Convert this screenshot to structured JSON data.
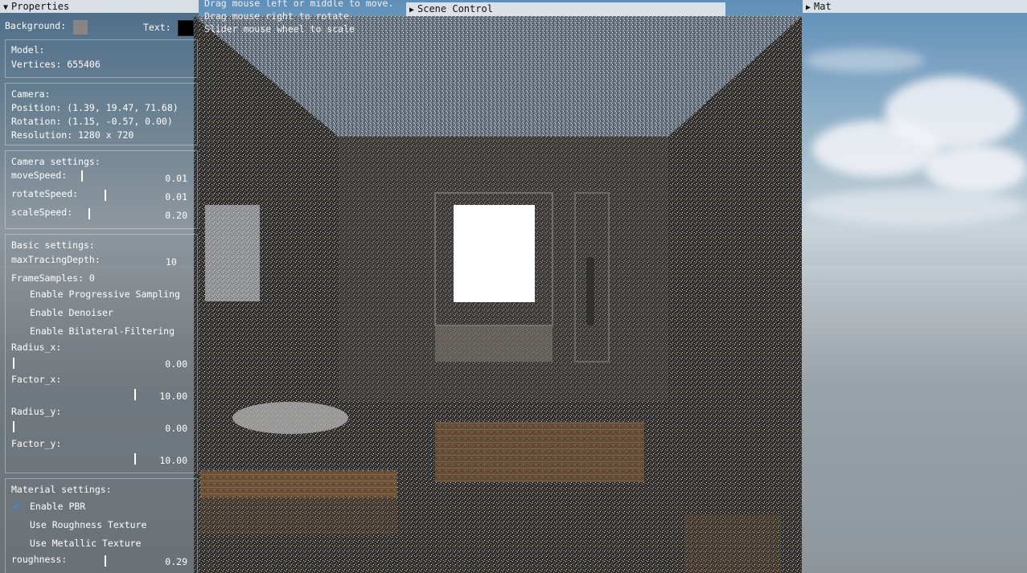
{
  "help_text": [
    "Drag mouse left or middle to move.",
    "Drag mouse right to rotate",
    "Slider mouse wheel to scale"
  ],
  "properties": {
    "title": "Properties",
    "background_label": "Background:",
    "background_color": "#8a8584",
    "text_label": "Text:",
    "text_color": "#000000",
    "model": {
      "heading": "Model:",
      "vertices": "Vertices: 655406"
    },
    "camera": {
      "heading": "Camera:",
      "position": "Position: (1.39, 19.47, 71.68)",
      "rotation": "Rotation: (1.15, -0.57, 0.00)",
      "resolution": "Resolution: 1280 x 720"
    },
    "camera_settings": {
      "heading": "Camera settings:",
      "move_label": "moveSpeed:",
      "move_value": "0.01",
      "rotate_label": "rotateSpeed:",
      "rotate_value": "0.01",
      "scale_label": "scaleSpeed:",
      "scale_value": "0.20"
    },
    "basic_settings": {
      "heading": "Basic settings:",
      "depth_label": "maxTracingDepth:",
      "depth_value": "10",
      "frame_samples": "FrameSamples: 0",
      "progressive": "Enable Progressive Sampling",
      "progressive_checked": false,
      "denoiser": "Enable Denoiser",
      "denoiser_checked": false,
      "bilateral": "Enable Bilateral-Filtering",
      "bilateral_checked": false,
      "radius_x_label": "Radius_x:",
      "radius_x_value": "0.00",
      "factor_x_label": "Factor_x:",
      "factor_x_value": "10.00",
      "radius_y_label": "Radius_y:",
      "radius_y_value": "0.00",
      "factor_y_label": "Factor_y:",
      "factor_y_value": "10.00"
    },
    "material_settings": {
      "heading": "Material settings:",
      "pbr": "Enable PBR",
      "pbr_checked": true,
      "roughness_tex": "Use Roughness Texture",
      "metallic_tex": "Use Metallic Texture",
      "roughness_label": "roughness:",
      "roughness_value": "0.29"
    }
  },
  "scene_control": {
    "title": "Scene Control"
  },
  "mat_panel": {
    "title": "Mat"
  },
  "icons": {
    "collapse": "▼",
    "expand": "▶",
    "check": "✔"
  }
}
